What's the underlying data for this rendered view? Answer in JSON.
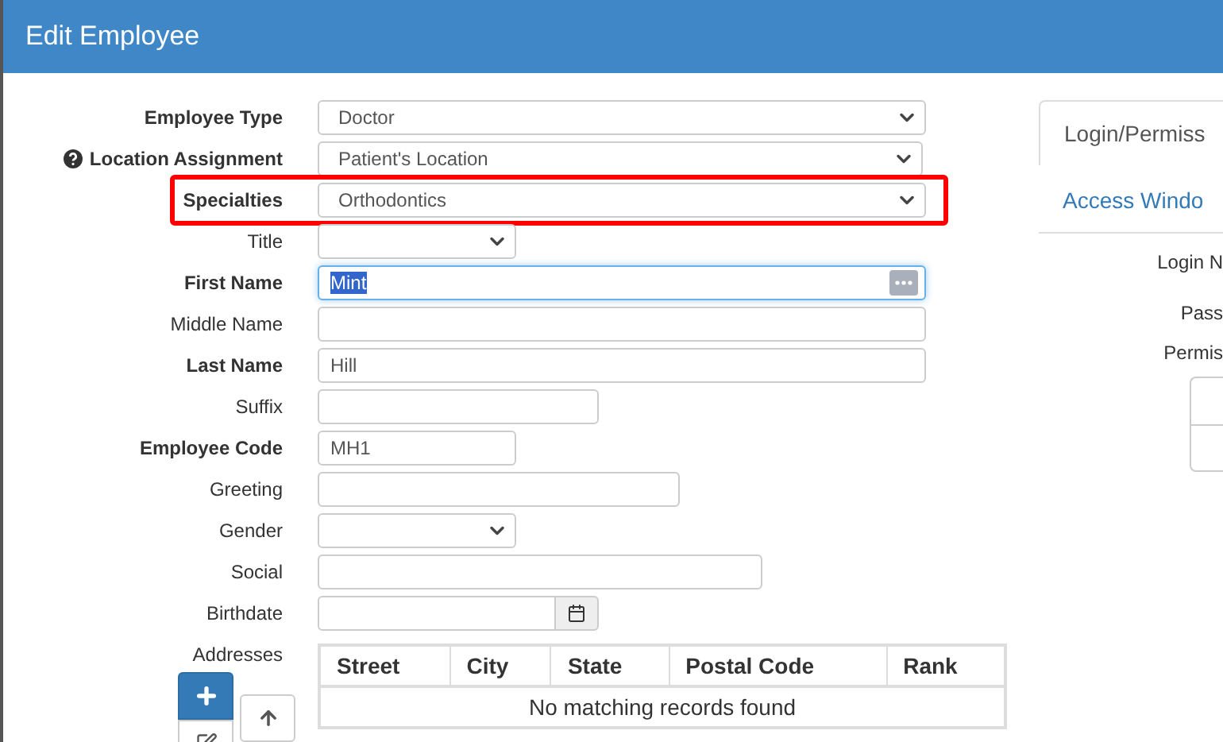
{
  "window": {
    "title": "Edit Employee"
  },
  "fields": [
    {
      "label": "Employee Type",
      "bold": true,
      "kind": "select",
      "value": "Doctor"
    },
    {
      "label": "Location Assignment",
      "bold": true,
      "kind": "select",
      "value": "Patient's Location",
      "help": true
    },
    {
      "label": "Specialties",
      "bold": true,
      "kind": "select",
      "value": "Orthodontics",
      "highlighted": true
    },
    {
      "label": "Title",
      "bold": false,
      "kind": "select"
    },
    {
      "label": "First Name",
      "bold": true,
      "kind": "input",
      "value": "Mint",
      "focused": true,
      "selected_text": true
    },
    {
      "label": "Middle Name",
      "bold": false,
      "kind": "input"
    },
    {
      "label": "Last Name",
      "bold": true,
      "kind": "input",
      "value": "Hill"
    },
    {
      "label": "Suffix",
      "bold": false,
      "kind": "input"
    },
    {
      "label": "Employee Code",
      "bold": true,
      "kind": "input",
      "value": "MH1"
    },
    {
      "label": "Greeting",
      "bold": false,
      "kind": "input"
    },
    {
      "label": "Gender",
      "bold": false,
      "kind": "select"
    },
    {
      "label": "Social",
      "bold": false,
      "kind": "input"
    },
    {
      "label": "Birthdate",
      "bold": false,
      "kind": "date"
    }
  ],
  "addresses": {
    "label": "Addresses",
    "columns": [
      "Street",
      "City",
      "State",
      "Postal Code",
      "Rank"
    ],
    "empty_message": "No matching records found"
  },
  "right_panel": {
    "tabs": [
      {
        "label": "Login/Permiss",
        "selected": true
      },
      {
        "label": "Access Windo",
        "selected": false
      }
    ],
    "labels": [
      "Login N",
      "Pass",
      "Permis"
    ]
  }
}
